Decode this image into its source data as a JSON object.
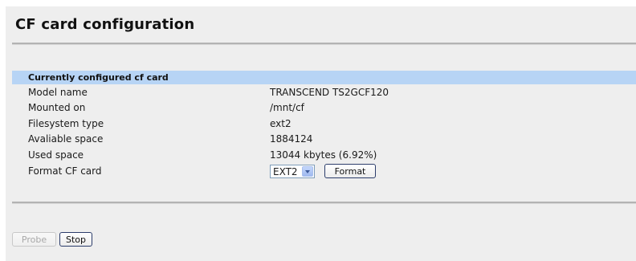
{
  "page": {
    "title": "CF card configuration"
  },
  "section": {
    "title": "Currently configured cf card"
  },
  "rows": [
    {
      "label": "Model name",
      "value": "TRANSCEND TS2GCF120"
    },
    {
      "label": "Mounted on",
      "value": "/mnt/cf"
    },
    {
      "label": "Filesystem type",
      "value": "ext2"
    },
    {
      "label": "Avaliable space",
      "value": "1884124"
    },
    {
      "label": "Used space",
      "value": "13044 kbytes (6.92%)"
    }
  ],
  "format": {
    "label": "Format CF card",
    "selected_fs": "EXT2",
    "button_label": "Format"
  },
  "footer": {
    "probe_label": "Probe",
    "stop_label": "Stop"
  },
  "colors": {
    "panel_bg": "#eeeeee",
    "section_header_bg": "#b7d4f5",
    "rule": "#b3b3b3"
  }
}
